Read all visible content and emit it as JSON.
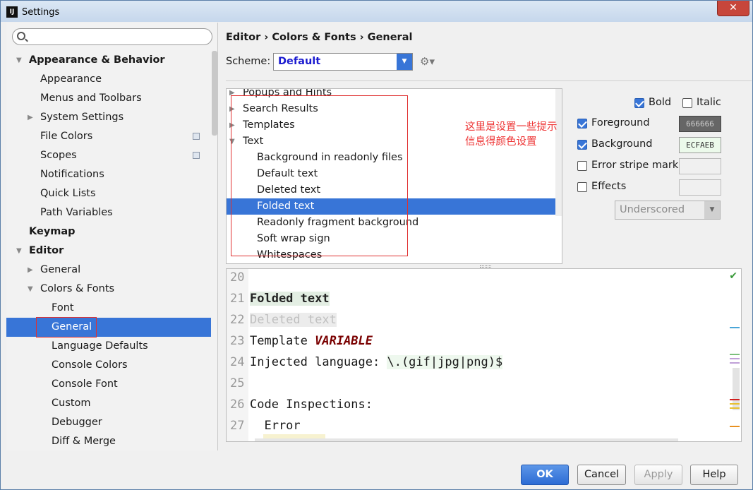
{
  "window": {
    "title": "Settings",
    "close_glyph": "✕",
    "app_icon_text": "IJ"
  },
  "search": {
    "placeholder": ""
  },
  "sidebar": {
    "items": [
      {
        "label": "Appearance & Behavior",
        "level": 0,
        "bold": true,
        "expanded": true
      },
      {
        "label": "Appearance",
        "level": 1
      },
      {
        "label": "Menus and Toolbars",
        "level": 1
      },
      {
        "label": "System Settings",
        "level": 1,
        "collapsed": true
      },
      {
        "label": "File Colors",
        "level": 1,
        "project_icon": true
      },
      {
        "label": "Scopes",
        "level": 1,
        "project_icon": true
      },
      {
        "label": "Notifications",
        "level": 1
      },
      {
        "label": "Quick Lists",
        "level": 1
      },
      {
        "label": "Path Variables",
        "level": 1
      },
      {
        "label": "Keymap",
        "level": 0,
        "bold": true
      },
      {
        "label": "Editor",
        "level": 0,
        "bold": true,
        "expanded": true
      },
      {
        "label": "General",
        "level": 1,
        "collapsed": true
      },
      {
        "label": "Colors & Fonts",
        "level": 1,
        "expanded": true
      },
      {
        "label": "Font",
        "level": 2
      },
      {
        "label": "General",
        "level": 2,
        "selected": true
      },
      {
        "label": "Language Defaults",
        "level": 2
      },
      {
        "label": "Console Colors",
        "level": 2
      },
      {
        "label": "Console Font",
        "level": 2
      },
      {
        "label": "Custom",
        "level": 2
      },
      {
        "label": "Debugger",
        "level": 2
      },
      {
        "label": "Diff & Merge",
        "level": 2
      }
    ]
  },
  "main": {
    "breadcrumb": "Editor › Colors & Fonts › General",
    "scheme_label": "Scheme:",
    "scheme_value": "Default",
    "tree": [
      {
        "label": "Popups and Hints",
        "level": 0,
        "collapsed": true
      },
      {
        "label": "Search Results",
        "level": 0,
        "collapsed": true
      },
      {
        "label": "Templates",
        "level": 0,
        "collapsed": true
      },
      {
        "label": "Text",
        "level": 0,
        "expanded": true
      },
      {
        "label": "Background in readonly files",
        "level": 1
      },
      {
        "label": "Default text",
        "level": 1
      },
      {
        "label": "Deleted text",
        "level": 1
      },
      {
        "label": "Folded text",
        "level": 1,
        "selected": true
      },
      {
        "label": "Readonly fragment background",
        "level": 1
      },
      {
        "label": "Soft wrap sign",
        "level": 1
      },
      {
        "label": "Whitespaces",
        "level": 1
      }
    ],
    "annotation": "这里是设置一些提示\n信息得颜色设置",
    "attributes": {
      "bold": {
        "label": "Bold",
        "checked": true
      },
      "italic": {
        "label": "Italic",
        "checked": false
      },
      "foreground": {
        "label": "Foreground",
        "checked": true,
        "value": "666666",
        "color": "#666666"
      },
      "background": {
        "label": "Background",
        "checked": true,
        "value": "ECFAEB",
        "color": "#ECFAEB"
      },
      "error_stripe": {
        "label": "Error stripe mark",
        "checked": false
      },
      "effects": {
        "label": "Effects",
        "checked": false
      },
      "effect_type": "Underscored"
    },
    "preview": {
      "lines": [
        {
          "num": "20",
          "text": ""
        },
        {
          "num": "21",
          "text": "Folded text"
        },
        {
          "num": "22",
          "text": "Deleted text"
        },
        {
          "num": "23",
          "prefix": "Template ",
          "highlight": "VARIABLE"
        },
        {
          "num": "24",
          "prefix": "Injected language: ",
          "highlight": "\\.(gif|jpg|png)$"
        },
        {
          "num": "25",
          "text": ""
        },
        {
          "num": "26",
          "text": "Code Inspections:"
        },
        {
          "num": "27",
          "text": "  Error"
        }
      ]
    }
  },
  "buttons": {
    "ok": "OK",
    "cancel": "Cancel",
    "apply": "Apply",
    "help": "Help"
  }
}
